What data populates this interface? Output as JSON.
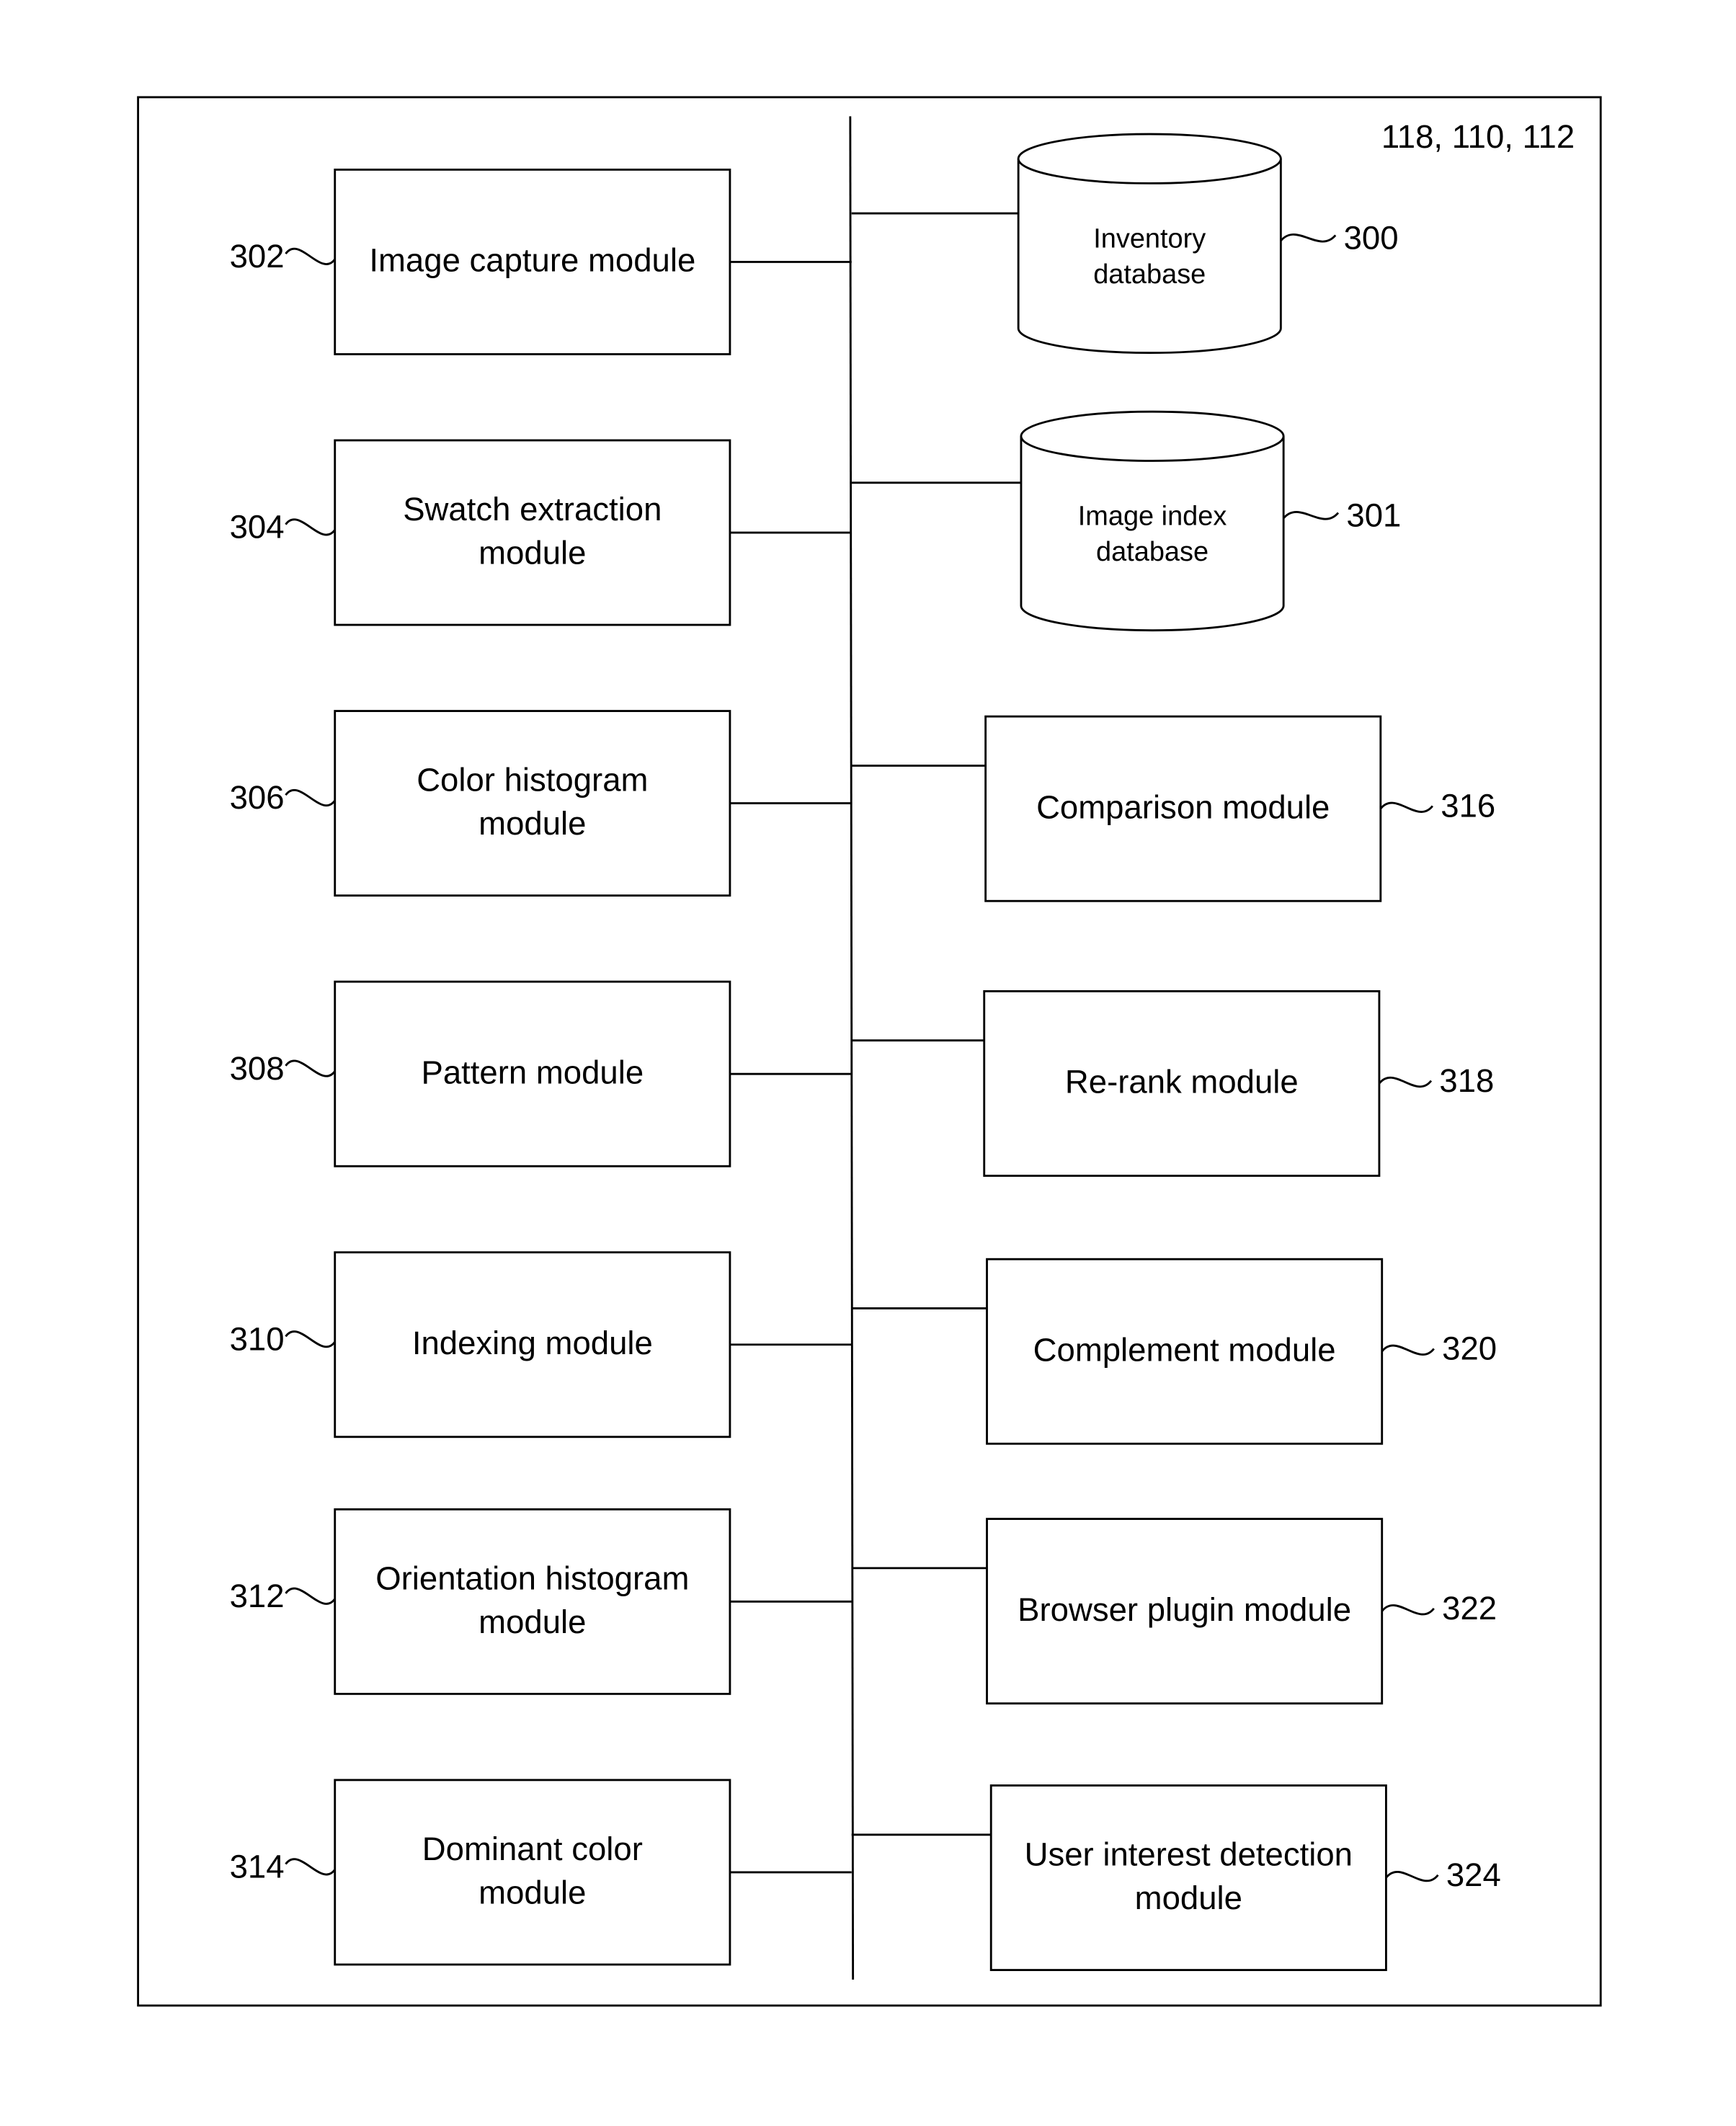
{
  "figure": {
    "system_ref": "118, 110, 112",
    "databases": [
      {
        "ref": "300",
        "lines": [
          "Inventory",
          "database"
        ]
      },
      {
        "ref": "301",
        "lines": [
          "Image index",
          "database"
        ]
      }
    ],
    "left_modules": [
      {
        "ref": "302",
        "lines": [
          "Image capture module"
        ]
      },
      {
        "ref": "304",
        "lines": [
          "Swatch extraction",
          "module"
        ]
      },
      {
        "ref": "306",
        "lines": [
          "Color histogram",
          "module"
        ]
      },
      {
        "ref": "308",
        "lines": [
          "Pattern module"
        ]
      },
      {
        "ref": "310",
        "lines": [
          "Indexing module"
        ]
      },
      {
        "ref": "312",
        "lines": [
          "Orientation histogram",
          "module"
        ]
      },
      {
        "ref": "314",
        "lines": [
          "Dominant color",
          "module"
        ]
      }
    ],
    "right_modules": [
      {
        "ref": "316",
        "lines": [
          "Comparison module"
        ]
      },
      {
        "ref": "318",
        "lines": [
          "Re-rank module"
        ]
      },
      {
        "ref": "320",
        "lines": [
          "Complement module"
        ]
      },
      {
        "ref": "322",
        "lines": [
          "Browser plugin module"
        ]
      },
      {
        "ref": "324",
        "lines": [
          "User interest detection",
          "module"
        ]
      }
    ]
  }
}
